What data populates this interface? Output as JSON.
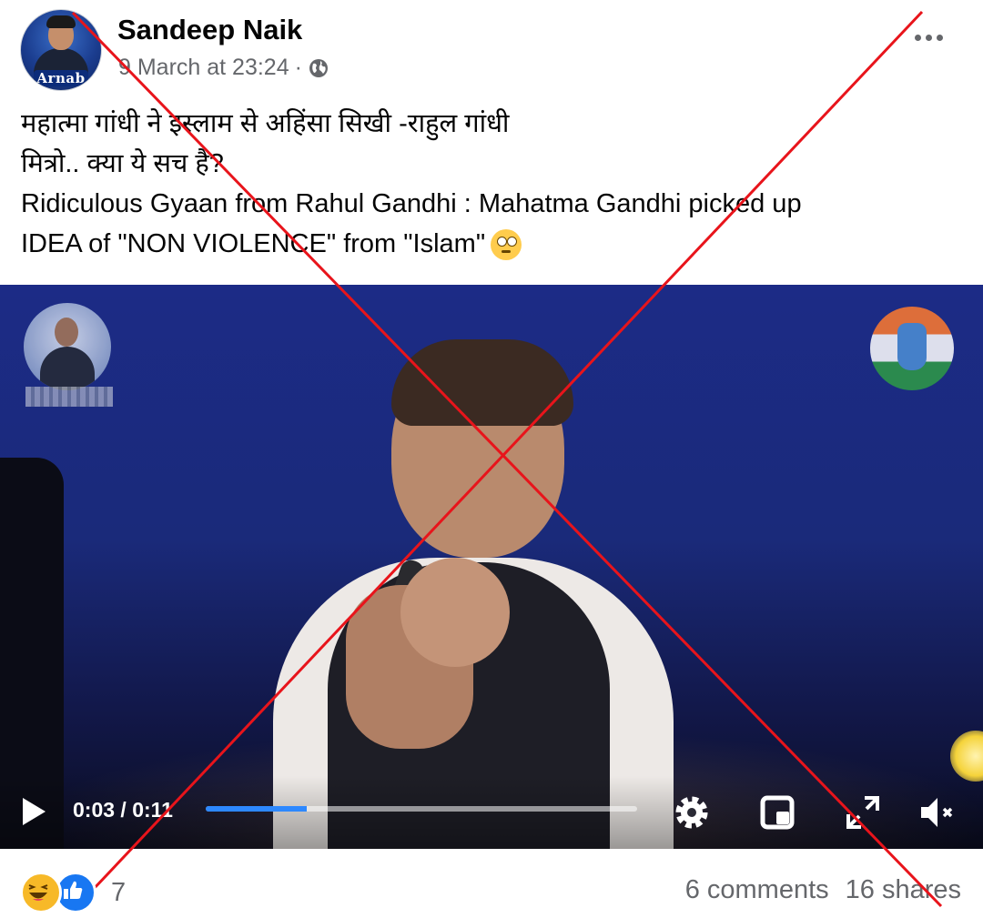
{
  "post": {
    "author": "Sandeep Naik",
    "avatar_brand": "Arnab",
    "timestamp": "9 March at 23:24",
    "separator": "·",
    "privacy_icon": "globe-icon",
    "text_lines": [
      "महात्मा गांधी ने इस्लाम से अहिंसा सिखी -राहुल गांधी",
      "मित्रो.. क्या ये सच है?",
      "Ridiculous Gyaan from Rahul Gandhi : Mahatma Gandhi picked up",
      "IDEA of \"NON VIOLENCE\" from \"Islam\""
    ],
    "emoji": "face-with-rolling-eyes"
  },
  "video": {
    "current_time": "0:03",
    "duration": "0:11",
    "time_display": "0:03 / 0:11",
    "progress_fraction": 0.235,
    "controls": [
      "play-icon",
      "gear-icon",
      "picture-in-picture-icon",
      "fullscreen-icon",
      "volume-muted-icon"
    ]
  },
  "footer": {
    "reaction_icons": [
      "haha-icon",
      "like-icon"
    ],
    "reaction_count": "7",
    "comments": "6 comments",
    "shares": "16 shares"
  },
  "colors": {
    "accent": "#1877f2",
    "progress": "#2d88ff",
    "secondary_text": "#65676b",
    "cross_mark": "#e8141b"
  }
}
